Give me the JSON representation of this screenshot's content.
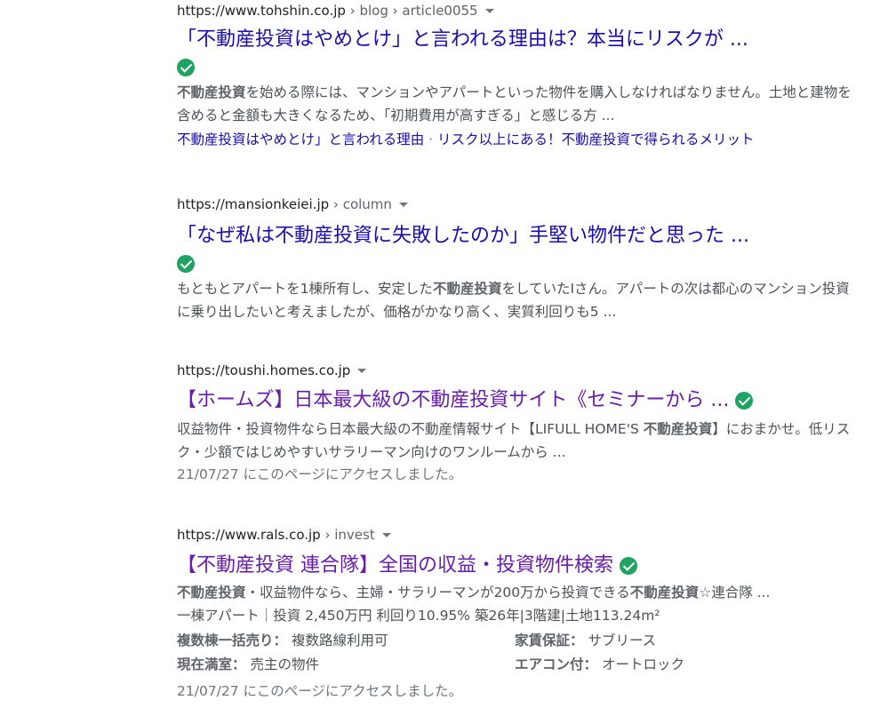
{
  "results": [
    {
      "url_host": "https://www.tohshin.co.jp",
      "url_path": " › blog › article0055",
      "title": "「不動産投資はやめとけ」と言われる理由は？本当にリスクが ...",
      "snippet_bold": "不動産投資",
      "snippet_rest": "を始める際には、マンションやアパートといった物件を購入しなければなりません。土地と建物を含めると金額も大きくなるため、「初期費用が高すぎる」と感じる方 ...",
      "sitelink_1": "不動産投資はやめとけ」と言われる理由",
      "sitelink_sep": " · ",
      "sitelink_2": "リスク以上にある！不動産投資で得られるメリット"
    },
    {
      "url_host": "https://mansionkeiei.jp",
      "url_path": " › column",
      "title": "「なぜ私は不動産投資に失敗したのか」手堅い物件だと思った ...",
      "snippet_pre": "もともとアパートを1棟所有し、安定した",
      "snippet_bold": "不動産投資",
      "snippet_post": "をしていたIさん。アパートの次は都心のマンション投資に乗り出したいと考えましたが、価格がかなり高く、実質利回りも5 ..."
    },
    {
      "url_host": "https://toushi.homes.co.jp",
      "title": "【ホームズ】日本最大級の不動産投資サイト《セミナーから ...",
      "snippet_pre": "収益物件・投資物件なら日本最大級の不動産情報サイト【LIFULL HOME'S ",
      "snippet_bold": "不動産投資",
      "snippet_post": "】におまかせ。低リスク・少額ではじめやすいサラリーマン向けのワンルームから ...",
      "date": "21/07/27 にこのページにアクセスしました。"
    },
    {
      "url_host": "https://www.rals.co.jp",
      "url_path": " › invest",
      "title": "【不動産投資 連合隊】全国の収益・投資物件検索",
      "snippet_bold1": "不動産投資",
      "snippet_mid": "・収益物件なら、主婦・サラリーマンが200万から投資できる",
      "snippet_bold2": "不動産投資",
      "snippet_post": "☆連合隊 ...",
      "info_line": "一棟アパート｜投資 2,450万円 利回り10.95% 築26年|3階建|土地113.24m²",
      "facts": [
        {
          "label": "複数棟一括売り：",
          "value": "複数路線利用可"
        },
        {
          "label": "家賃保証：",
          "value": "サブリース"
        },
        {
          "label": "現在満室：",
          "value": "売主の物件"
        },
        {
          "label": "エアコン付：",
          "value": "オートロック"
        }
      ],
      "date": "21/07/27 にこのページにアクセスしました。"
    }
  ],
  "icons": {
    "verified": "verified-check-icon",
    "menu": "chevron-down-icon"
  },
  "colors": {
    "link": "#1a0dab",
    "visited": "#681da8",
    "verified": "#1ea362"
  }
}
